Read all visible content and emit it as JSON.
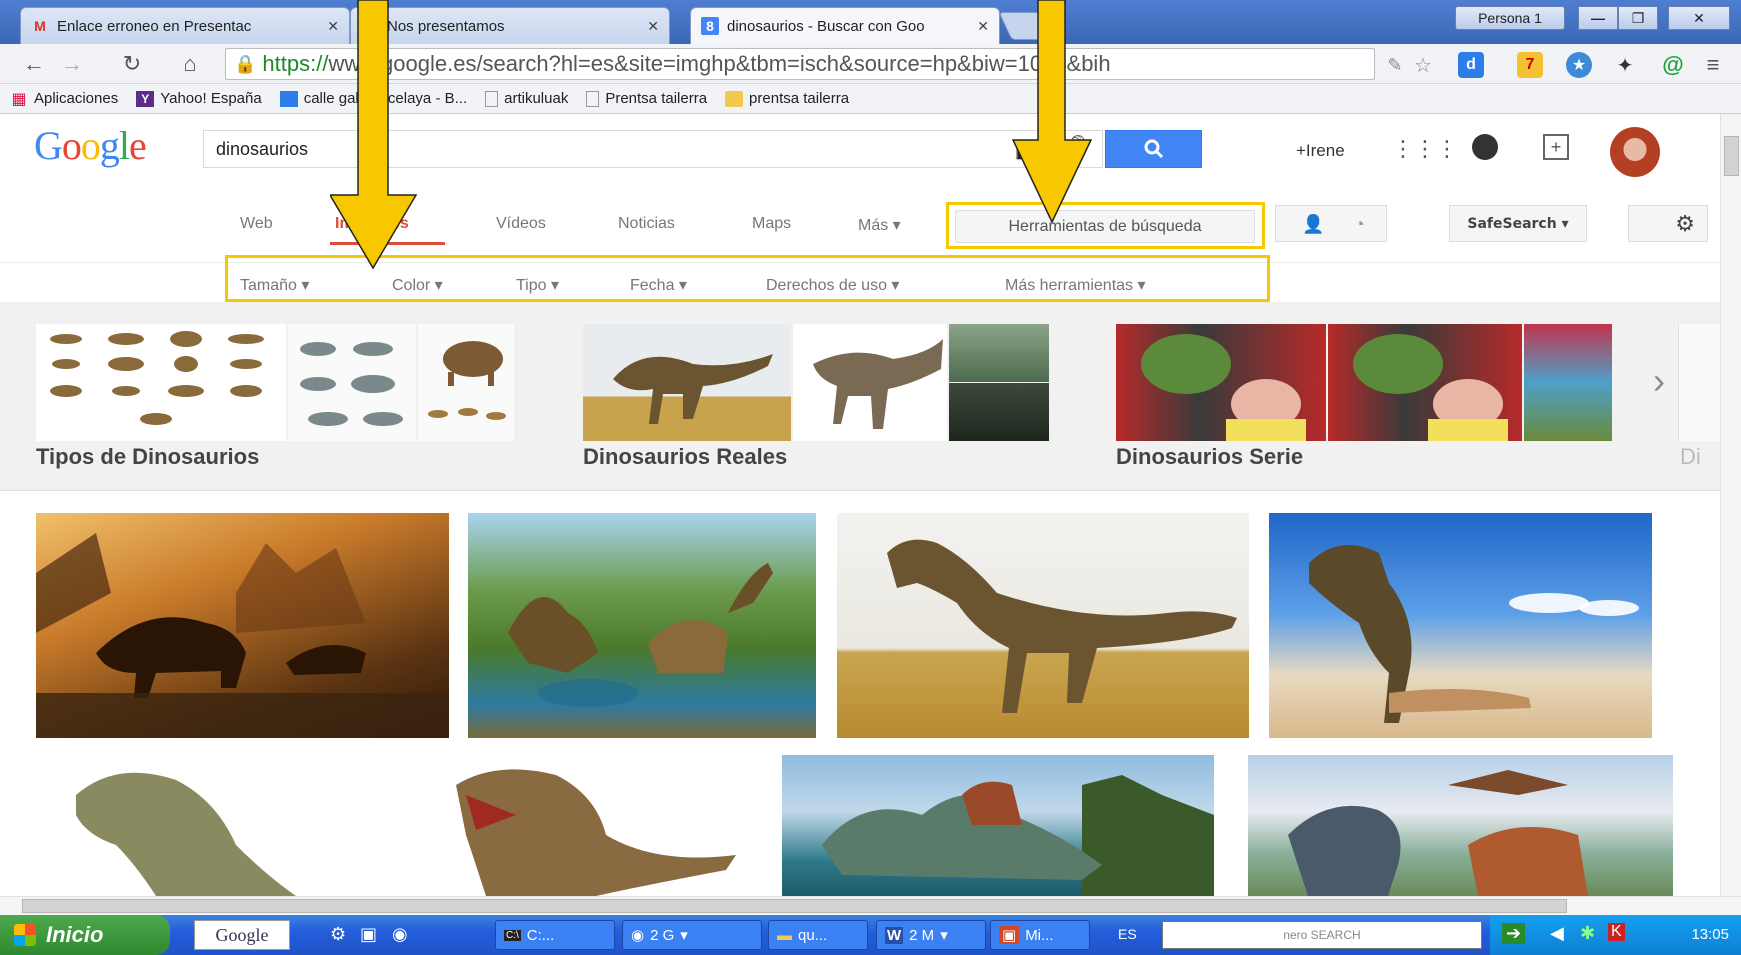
{
  "tabs": [
    {
      "title": "Enlace erroneo en Presentac",
      "favicon": "gmail-icon"
    },
    {
      "title": "Nos presentamos",
      "favicon": "doc-icon"
    },
    {
      "title": "dinosaurios - Buscar con Goo",
      "favicon": "google-icon"
    }
  ],
  "window": {
    "profile": "Persona 1"
  },
  "toolbar": {
    "url_protocol": "https://",
    "url_rest": "www.google.es/search?hl=es&site=imghp&tbm=isch&source=hp&biw=1024&bih"
  },
  "bookmarks": [
    {
      "label": "Aplicaciones",
      "icon": "apps-grid-icon"
    },
    {
      "label": "Yahoo! España",
      "icon": "yahoo-icon"
    },
    {
      "label": "calle gabriel celaya - B...",
      "icon": "page-icon"
    },
    {
      "label": "artikuluak",
      "icon": "page-icon"
    },
    {
      "label": "Prentsa tailerra",
      "icon": "page-icon"
    },
    {
      "label": "prentsa tailerra",
      "icon": "folder-icon"
    }
  ],
  "google": {
    "query": "dinosaurios",
    "user": "+Irene"
  },
  "nav": {
    "web": "Web",
    "images": "Imágenes",
    "videos": "Vídeos",
    "news": "Noticias",
    "maps": "Maps",
    "more": "Más ▾",
    "tools": "Herramientas de búsqueda",
    "safesearch": "SafeSearch ▾"
  },
  "filters": [
    "Tamaño ▾",
    "Color ▾",
    "Tipo ▾",
    "Fecha ▾",
    "Derechos de uso ▾",
    "Más herramientas ▾"
  ],
  "related": [
    {
      "label": "Tipos de Dinosaurios"
    },
    {
      "label": "Dinosaurios Reales"
    },
    {
      "label": "Dinosaurios Serie"
    },
    {
      "label": "Di"
    }
  ],
  "taskbar": {
    "start": "Inicio",
    "google": "Google",
    "tasks": [
      "C:...",
      "2 G",
      "qu...",
      "2 M",
      "Mi..."
    ],
    "lang": "ES",
    "nero": "nero SEARCH",
    "clock": "13:05"
  },
  "colors": {
    "annotation": "#f7c800",
    "google_blue": "#4285f4",
    "active_red": "#dd4b39"
  }
}
